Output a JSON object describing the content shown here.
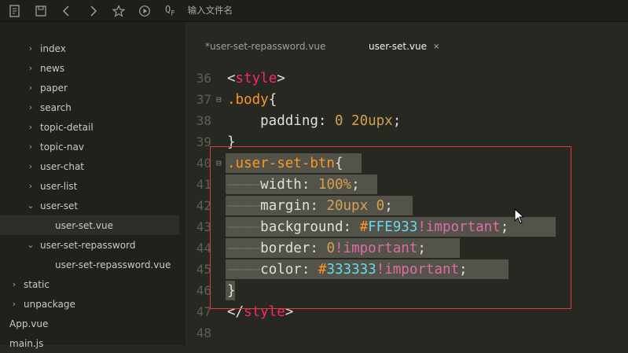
{
  "toolbar": {
    "search_shortcut": "Q",
    "search_shortcut_sub": "F",
    "search_placeholder": "输入文件名",
    "icons": [
      "new-file-icon",
      "save-icon",
      "back-icon",
      "forward-icon",
      "star-icon",
      "run-icon"
    ]
  },
  "sidebar": {
    "items": [
      {
        "label": "index",
        "expanded": false,
        "level": 1
      },
      {
        "label": "news",
        "expanded": false,
        "level": 1
      },
      {
        "label": "paper",
        "expanded": false,
        "level": 1
      },
      {
        "label": "search",
        "expanded": false,
        "level": 1
      },
      {
        "label": "topic-detail",
        "expanded": false,
        "level": 1
      },
      {
        "label": "topic-nav",
        "expanded": false,
        "level": 1
      },
      {
        "label": "user-chat",
        "expanded": false,
        "level": 1
      },
      {
        "label": "user-list",
        "expanded": false,
        "level": 1
      },
      {
        "label": "user-set",
        "expanded": true,
        "level": 1
      },
      {
        "label": "user-set.vue",
        "level": 2,
        "selected": true
      },
      {
        "label": "user-set-repassword",
        "expanded": true,
        "level": 1
      },
      {
        "label": "user-set-repassword.vue",
        "level": 2
      },
      {
        "label": "static",
        "expanded": false,
        "level": 0
      },
      {
        "label": "unpackage",
        "expanded": false,
        "level": 0
      },
      {
        "label": "App.vue",
        "level": 0
      },
      {
        "label": "main.js",
        "level": 0
      }
    ]
  },
  "tabs": [
    {
      "label": "*user-set-repassword.vue",
      "active": false
    },
    {
      "label": "user-set.vue",
      "active": true,
      "close": "×"
    }
  ],
  "code": {
    "lines": [
      {
        "n": "36",
        "parts": [
          [
            "c-prop",
            "<"
          ],
          [
            "c-tag",
            "style"
          ],
          [
            "c-prop",
            ">"
          ]
        ]
      },
      {
        "n": "37",
        "fold": "⊟",
        "parts": [
          [
            "c-sel2",
            ".body"
          ],
          [
            "c-prop",
            "{"
          ]
        ]
      },
      {
        "n": "38",
        "parts": [
          [
            "c-prop",
            "    padding: "
          ],
          [
            "c-num",
            "0 20upx"
          ],
          [
            "c-prop",
            ";"
          ]
        ]
      },
      {
        "n": "39",
        "parts": [
          [
            "c-prop",
            "}"
          ]
        ]
      },
      {
        "n": "40",
        "fold": "⊟",
        "parts": [
          [
            "c-sel2",
            ".user-set-btn"
          ],
          [
            "c-prop",
            "{"
          ]
        ]
      },
      {
        "n": "41",
        "parts": [
          [
            "guide",
            "————"
          ],
          [
            "c-prop",
            "width: "
          ],
          [
            "c-num",
            "100%"
          ],
          [
            "c-prop",
            ";"
          ]
        ]
      },
      {
        "n": "42",
        "parts": [
          [
            "guide",
            "————"
          ],
          [
            "c-prop",
            "margin: "
          ],
          [
            "c-num",
            "20upx 0"
          ],
          [
            "c-prop",
            ";"
          ]
        ]
      },
      {
        "n": "43",
        "parts": [
          [
            "guide",
            "————"
          ],
          [
            "c-prop",
            "background: "
          ],
          [
            "c-sel2",
            "#"
          ],
          [
            "c-hex",
            "FFE933"
          ],
          [
            "c-imp",
            "!important"
          ],
          [
            "c-prop",
            ";"
          ]
        ]
      },
      {
        "n": "44",
        "parts": [
          [
            "guide",
            "————"
          ],
          [
            "c-prop",
            "border: "
          ],
          [
            "c-num",
            "0"
          ],
          [
            "c-imp",
            "!important"
          ],
          [
            "c-prop",
            ";"
          ]
        ]
      },
      {
        "n": "45",
        "parts": [
          [
            "guide",
            "————"
          ],
          [
            "c-prop",
            "color: "
          ],
          [
            "c-sel2",
            "#"
          ],
          [
            "c-hex",
            "333333"
          ],
          [
            "c-imp",
            "!important"
          ],
          [
            "c-prop",
            ";"
          ]
        ]
      },
      {
        "n": "46",
        "parts": [
          [
            "c-prop",
            "}"
          ]
        ]
      },
      {
        "n": "47",
        "parts": [
          [
            "c-prop",
            "</"
          ],
          [
            "c-tag",
            "style"
          ],
          [
            "c-prop",
            ">"
          ]
        ]
      },
      {
        "n": "48",
        "parts": []
      }
    ]
  },
  "colors": {
    "background": "#272822",
    "sidebar": "#20211c",
    "highlight_box": "#e53935",
    "selection": "#53534a"
  }
}
